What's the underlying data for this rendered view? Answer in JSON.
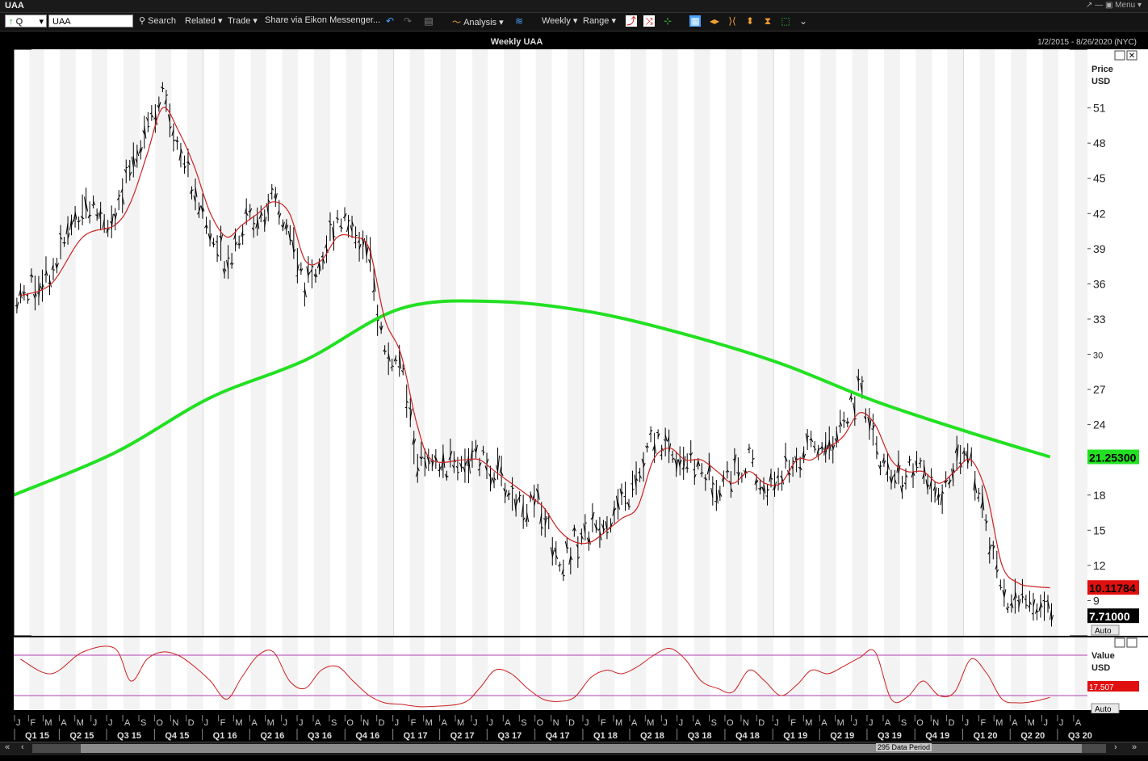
{
  "window": {
    "title": "UAA",
    "menu_label": "Menu"
  },
  "toolbar": {
    "quote_type": "Q",
    "ric_value": "UAA",
    "search": "Search",
    "related": "Related",
    "trade": "Trade",
    "share": "Share via Eikon Messenger...",
    "analysis": "Analysis",
    "interval": "Weekly",
    "range": "Range"
  },
  "header": {
    "title": "Weekly UAA",
    "date_range": "1/2/2015 - 8/26/2020 (NYC)"
  },
  "price_panel": {
    "axis_title": "Price",
    "axis_unit": "USD",
    "ticks": [
      9,
      12,
      15,
      18,
      21,
      24,
      27,
      30,
      33,
      36,
      39,
      42,
      45,
      48,
      51
    ],
    "tag_sma_long": "21.25300",
    "tag_sma_short": "10.11784",
    "tag_last": "7.71000",
    "auto_label": "Auto"
  },
  "osc_panel": {
    "axis_title": "Value",
    "axis_unit": "USD",
    "tag_value": "17.507",
    "auto_label": "Auto"
  },
  "x_axis": {
    "months": [
      "J",
      "F",
      "M",
      "A",
      "M",
      "J",
      "J",
      "A",
      "S",
      "O",
      "N",
      "D",
      "J",
      "F",
      "M",
      "A",
      "M",
      "J",
      "J",
      "A",
      "S",
      "O",
      "N",
      "D",
      "J",
      "F",
      "M",
      "A",
      "M",
      "J",
      "J",
      "A",
      "S",
      "O",
      "N",
      "D",
      "J",
      "F",
      "M",
      "A",
      "M",
      "J",
      "J",
      "A",
      "S",
      "O",
      "N",
      "D",
      "J",
      "F",
      "M",
      "A",
      "M",
      "J",
      "J",
      "A",
      "S",
      "O",
      "N",
      "D",
      "J",
      "F",
      "M",
      "A",
      "M",
      "J",
      "J",
      "A"
    ],
    "quarters": [
      "Q1 15",
      "Q2 15",
      "Q3 15",
      "Q4 15",
      "Q1 16",
      "Q2 16",
      "Q3 16",
      "Q4 16",
      "Q1 17",
      "Q2 17",
      "Q3 17",
      "Q4 17",
      "Q1 18",
      "Q2 18",
      "Q3 18",
      "Q4 18",
      "Q1 19",
      "Q2 19",
      "Q3 19",
      "Q4 19",
      "Q1 20",
      "Q2 20",
      "Q3 20"
    ]
  },
  "footer": {
    "data_period": "295 Data Period"
  },
  "colors": {
    "sma_long": "#22e022",
    "sma_short": "#cc2020",
    "osc_line": "#cc2020",
    "osc_bands": "#b040b0",
    "tag_green": "#22e022",
    "tag_red": "#e01010"
  },
  "chart_data": {
    "type": "line",
    "title": "Weekly UAA",
    "ylabel": "Price USD",
    "ylim": [
      6,
      56
    ],
    "x_start": "2015-01-02",
    "x_end": "2020-08-26",
    "series": [
      {
        "style": "ohlc-bars",
        "x": [
          "2015-01",
          "2015-03",
          "2015-05",
          "2015-07",
          "2015-08",
          "2015-09",
          "2015-10",
          "2015-11",
          "2015-12",
          "2016-01",
          "2016-02",
          "2016-03",
          "2016-04",
          "2016-05",
          "2016-06",
          "2016-07",
          "2016-08",
          "2016-09",
          "2016-10",
          "2016-11",
          "2016-12",
          "2017-01",
          "2017-02",
          "2017-03",
          "2017-05",
          "2017-06",
          "2017-07",
          "2017-08",
          "2017-09",
          "2017-10",
          "2017-11",
          "2017-12",
          "2018-01",
          "2018-02",
          "2018-03",
          "2018-04",
          "2018-05",
          "2018-06",
          "2018-07",
          "2018-08",
          "2018-09",
          "2018-10",
          "2018-11",
          "2018-12",
          "2019-01",
          "2019-02",
          "2019-03",
          "2019-04",
          "2019-05",
          "2019-06",
          "2019-07",
          "2019-08",
          "2019-09",
          "2019-10",
          "2019-11",
          "2019-12",
          "2020-01",
          "2020-02",
          "2020-03",
          "2020-04",
          "2020-05",
          "2020-06"
        ],
        "values": [
          35,
          37,
          43,
          41,
          46,
          50,
          52,
          48,
          44,
          40,
          38,
          41,
          42,
          43,
          40,
          36,
          38,
          42,
          41,
          38,
          30,
          29,
          21,
          20,
          21,
          21,
          20,
          18,
          17,
          17,
          12,
          14,
          15,
          16,
          17,
          19,
          23,
          22,
          21,
          20,
          19,
          20,
          21,
          18,
          20,
          21,
          22,
          22,
          24,
          27,
          22,
          19,
          20,
          20,
          17,
          21,
          21,
          15,
          9,
          9,
          9,
          8
        ]
      },
      {
        "style": "sma-long",
        "x": [
          "2015-01",
          "2015-07",
          "2016-01",
          "2016-07",
          "2017-01",
          "2017-07",
          "2018-01",
          "2018-07",
          "2019-01",
          "2019-07",
          "2020-01",
          "2020-06"
        ],
        "values": [
          18,
          21.6,
          26.3,
          29.5,
          33.9,
          34.5,
          33.6,
          31.7,
          29.2,
          26,
          23.3,
          21.25
        ]
      },
      {
        "style": "sma-short",
        "x": [
          "2015-01",
          "2015-03",
          "2015-05",
          "2015-07",
          "2015-08",
          "2015-09",
          "2015-10",
          "2015-11",
          "2015-12",
          "2016-01",
          "2016-02",
          "2016-03",
          "2016-04",
          "2016-05",
          "2016-06",
          "2016-07",
          "2016-08",
          "2016-09",
          "2016-10",
          "2016-11",
          "2016-12",
          "2017-01",
          "2017-02",
          "2017-03",
          "2017-05",
          "2017-06",
          "2017-07",
          "2017-08",
          "2017-09",
          "2017-10",
          "2017-11",
          "2017-12",
          "2018-01",
          "2018-02",
          "2018-03",
          "2018-04",
          "2018-05",
          "2018-06",
          "2018-07",
          "2018-08",
          "2018-09",
          "2018-10",
          "2018-11",
          "2018-12",
          "2019-01",
          "2019-02",
          "2019-03",
          "2019-04",
          "2019-05",
          "2019-06",
          "2019-07",
          "2019-08",
          "2019-09",
          "2019-10",
          "2019-11",
          "2019-12",
          "2020-01",
          "2020-02",
          "2020-03",
          "2020-04",
          "2020-05",
          "2020-06"
        ],
        "values": [
          35,
          36,
          40,
          41,
          43,
          47,
          51,
          49,
          46,
          42,
          40,
          41,
          42,
          43,
          42,
          38,
          38,
          40,
          40,
          39,
          33,
          30,
          24,
          21,
          21,
          21,
          20,
          19,
          18,
          17,
          15,
          14,
          14,
          15,
          16,
          17,
          21,
          22,
          21,
          21,
          20,
          19,
          20,
          19,
          19,
          21,
          21,
          22,
          23,
          25,
          24,
          21,
          20,
          20,
          19,
          20,
          21,
          18,
          12,
          10.5,
          10.2,
          10.1
        ]
      }
    ],
    "oscillator": {
      "x": [
        "2015-01",
        "2015-03",
        "2015-05",
        "2015-07",
        "2015-08",
        "2015-09",
        "2015-10",
        "2015-11",
        "2015-12",
        "2016-01",
        "2016-02",
        "2016-03",
        "2016-04",
        "2016-05",
        "2016-06",
        "2016-07",
        "2016-08",
        "2016-09",
        "2016-10",
        "2016-11",
        "2016-12",
        "2017-01",
        "2017-02",
        "2017-03",
        "2017-05",
        "2017-06",
        "2017-07",
        "2017-08",
        "2017-09",
        "2017-10",
        "2017-11",
        "2017-12",
        "2018-01",
        "2018-02",
        "2018-03",
        "2018-04",
        "2018-05",
        "2018-06",
        "2018-07",
        "2018-08",
        "2018-09",
        "2018-10",
        "2018-11",
        "2018-12",
        "2019-01",
        "2019-02",
        "2019-03",
        "2019-04",
        "2019-05",
        "2019-06",
        "2019-07",
        "2019-08",
        "2019-09",
        "2019-10",
        "2019-11",
        "2019-12",
        "2020-01",
        "2020-02",
        "2020-03",
        "2020-04",
        "2020-05",
        "2020-06"
      ],
      "values": [
        70,
        50,
        80,
        85,
        40,
        70,
        80,
        75,
        60,
        40,
        15,
        45,
        75,
        80,
        40,
        30,
        55,
        60,
        40,
        20,
        10,
        8,
        5,
        5,
        10,
        30,
        55,
        50,
        30,
        15,
        12,
        18,
        45,
        55,
        50,
        60,
        75,
        85,
        70,
        40,
        30,
        25,
        55,
        40,
        20,
        35,
        55,
        50,
        60,
        72,
        80,
        15,
        18,
        40,
        20,
        25,
        70,
        50,
        15,
        10,
        12,
        17.5
      ]
    }
  }
}
